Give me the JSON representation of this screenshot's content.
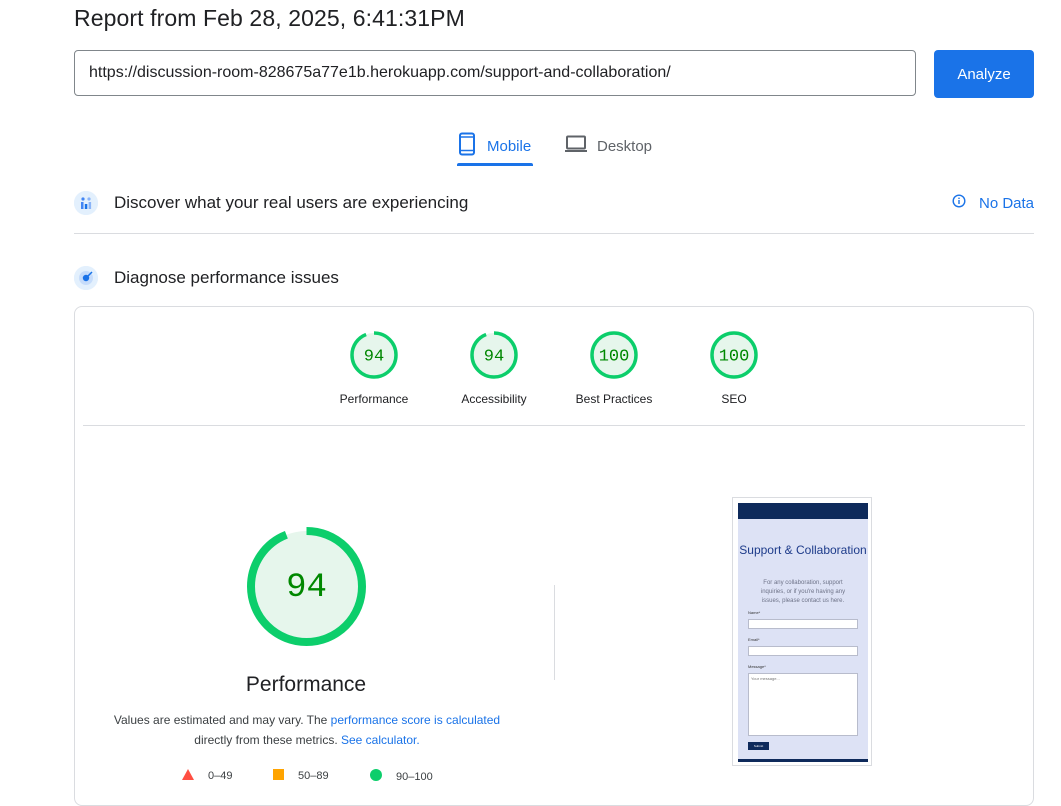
{
  "header": {
    "title": "Report from Feb 28, 2025, 6:41:31PM",
    "url_value": "https://discussion-room-828675a77e1b.herokuapp.com/support-and-collaboration/",
    "analyze_label": "Analyze"
  },
  "tabs": {
    "mobile": "Mobile",
    "desktop": "Desktop",
    "active": "Mobile"
  },
  "field_data": {
    "title": "Discover what your real users are experiencing",
    "status": "No Data"
  },
  "diagnose": {
    "title": "Diagnose performance issues"
  },
  "scores": [
    {
      "label": "Performance",
      "value": "94",
      "fraction": 0.94
    },
    {
      "label": "Accessibility",
      "value": "94",
      "fraction": 0.94
    },
    {
      "label": "Best Practices",
      "value": "100",
      "fraction": 1.0
    },
    {
      "label": "SEO",
      "value": "100",
      "fraction": 1.0
    }
  ],
  "performance": {
    "score": "94",
    "fraction": 0.94,
    "label": "Performance",
    "desc_prefix": "Values are estimated and may vary. The ",
    "desc_link": "performance score is calculated",
    "desc_mid": "directly from these metrics. ",
    "desc_calc_link": "See calculator."
  },
  "legend": {
    "fail": "0–49",
    "average": "50–89",
    "pass": "90–100"
  },
  "screenshot": {
    "heading": "Support & Collaboration",
    "subtext": "For any collaboration, support inquiries, or if you're having any issues, please contact us here.",
    "name_label": "Name*",
    "email_label": "Email*",
    "message_label": "Message*",
    "message_placeholder": "Your message...",
    "submit_label": "Submit"
  },
  "colors": {
    "accent": "#1a73e8",
    "pass": "#0cce6b",
    "pass_text": "#008800",
    "pass_bg": "#e6f6ec",
    "average": "#ffa400",
    "fail": "#ff4e42"
  }
}
